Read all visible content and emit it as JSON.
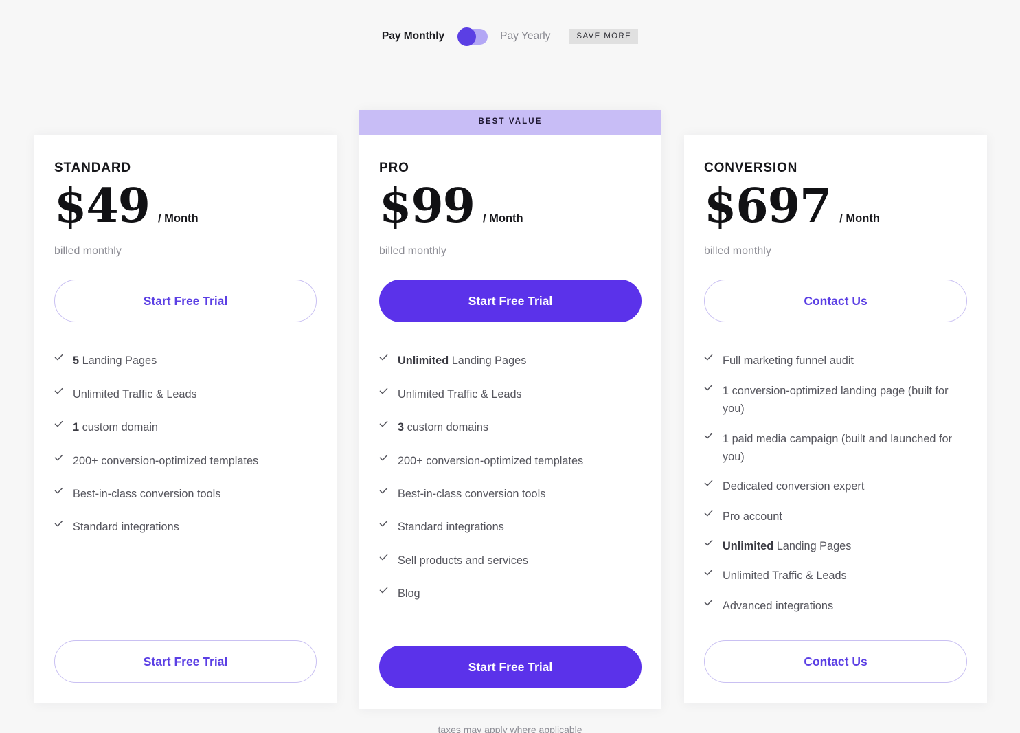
{
  "billing_toggle": {
    "monthly_label": "Pay Monthly",
    "yearly_label": "Pay Yearly",
    "save_badge": "SAVE MORE",
    "selected": "monthly",
    "accent_color": "#5b3fe4",
    "track_color": "#b3a7f5",
    "badge_bg": "#e0e0e0"
  },
  "page": {
    "background": "#f7f7f7",
    "card_background": "#ffffff",
    "footnote": "taxes may apply where applicable"
  },
  "plans": [
    {
      "name": "STANDARD",
      "price": "$49",
      "period": "/ Month",
      "billed": "billed monthly",
      "cta_top": "Start Free Trial",
      "cta_bottom": "Start Free Trial",
      "cta_style": "outline",
      "highlighted": false,
      "badge": "",
      "features": [
        {
          "bold": "5",
          "rest": " Landing Pages"
        },
        {
          "bold": "",
          "rest": "Unlimited Traffic & Leads"
        },
        {
          "bold": "1",
          "rest": " custom domain"
        },
        {
          "bold": "",
          "rest": "200+ conversion-optimized templates"
        },
        {
          "bold": "",
          "rest": "Best-in-class conversion tools"
        },
        {
          "bold": "",
          "rest": "Standard integrations"
        }
      ]
    },
    {
      "name": "PRO",
      "price": "$99",
      "period": "/ Month",
      "billed": "billed monthly",
      "cta_top": "Start Free Trial",
      "cta_bottom": "Start Free Trial",
      "cta_style": "filled",
      "highlighted": true,
      "badge": "BEST VALUE",
      "badge_bg": "#c8bdf6",
      "features": [
        {
          "bold": "Unlimited",
          "rest": " Landing Pages"
        },
        {
          "bold": "",
          "rest": "Unlimited Traffic & Leads"
        },
        {
          "bold": "3",
          "rest": " custom domains"
        },
        {
          "bold": "",
          "rest": "200+ conversion-optimized templates"
        },
        {
          "bold": "",
          "rest": "Best-in-class conversion tools"
        },
        {
          "bold": "",
          "rest": "Standard integrations"
        },
        {
          "bold": "",
          "rest": "Sell products and services"
        },
        {
          "bold": "",
          "rest": "Blog"
        }
      ]
    },
    {
      "name": "CONVERSION",
      "price": "$697",
      "period": "/ Month",
      "billed": "billed monthly",
      "cta_top": "Contact Us",
      "cta_bottom": "Contact Us",
      "cta_style": "outline",
      "highlighted": false,
      "badge": "",
      "features": [
        {
          "bold": "",
          "rest": "Full marketing funnel audit"
        },
        {
          "bold": "",
          "rest": "1 conversion-optimized landing page (built for you)"
        },
        {
          "bold": "",
          "rest": "1 paid media campaign (built and launched for you)"
        },
        {
          "bold": "",
          "rest": "Dedicated conversion expert"
        },
        {
          "bold": "",
          "rest": "Pro account"
        },
        {
          "bold": "Unlimited",
          "rest": " Landing Pages"
        },
        {
          "bold": "",
          "rest": "Unlimited Traffic & Leads"
        },
        {
          "bold": "",
          "rest": "Advanced integrations"
        }
      ]
    }
  ]
}
